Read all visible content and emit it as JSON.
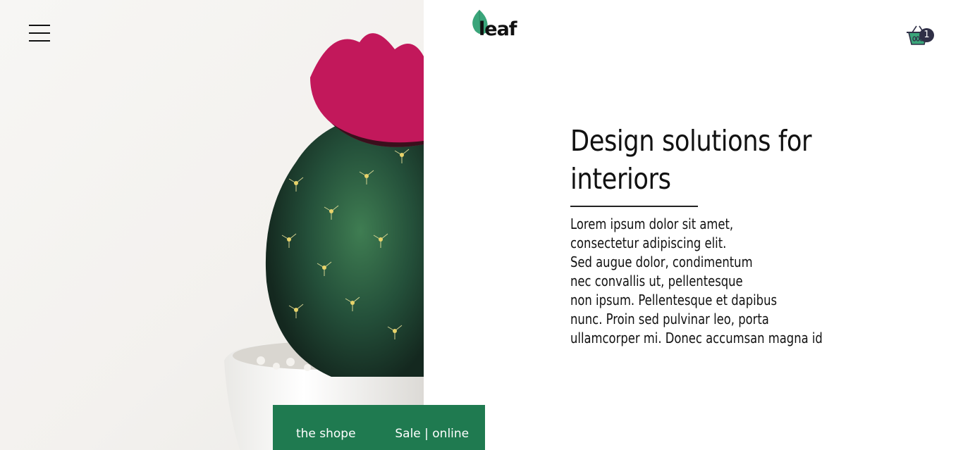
{
  "header": {
    "logo_text": "leaf",
    "cart_count": "1"
  },
  "hero": {
    "headline_line1": "Design solutions for",
    "headline_line2": "interiors",
    "body_lines": [
      "Lorem ipsum dolor sit amet,",
      "consectetur adipiscing elit.",
      "Sed augue dolor, condimentum",
      "nec convallis ut, pellentesque",
      "non ipsum. Pellentesque et dapibus",
      "nunc. Proin sed pulvinar leo, porta",
      "ullamcorper mi. Donec accumsan magna id"
    ]
  },
  "tabs": [
    {
      "label": "the shope"
    },
    {
      "label": "Sale | online"
    }
  ],
  "colors": {
    "brand_green": "#1f7a50",
    "leaf_green": "#3aa57a",
    "badge": "#2f2f46",
    "flower": "#c2185b"
  }
}
